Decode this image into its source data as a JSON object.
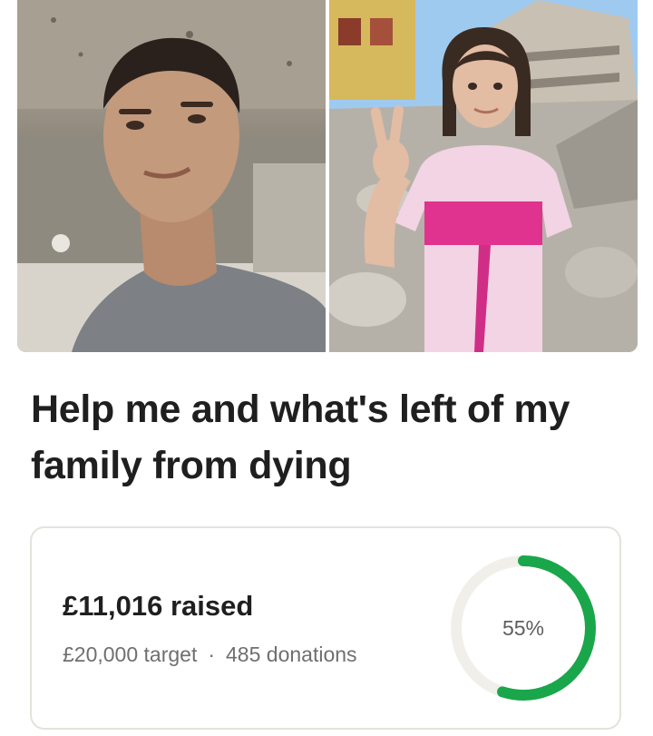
{
  "fundraiser": {
    "title": "Help me and what's left of my family from dying",
    "raised": "£11,016 raised",
    "target": "£20,000 target",
    "separator": "·",
    "donations": "485 donations",
    "progress_percent_label": "55%",
    "progress_fraction": 0.55
  },
  "colors": {
    "accent": "#1aa64a",
    "track": "#f1efea",
    "text": "#1f1f1f",
    "muted": "#6f6f6f"
  }
}
